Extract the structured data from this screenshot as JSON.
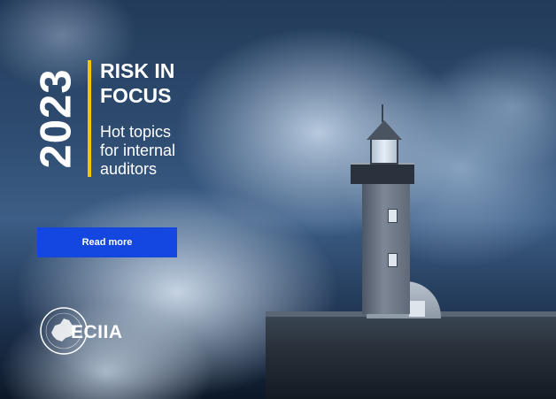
{
  "banner": {
    "year": "2023",
    "title_line_1": "RISK IN",
    "title_line_2": "FOCUS",
    "subtitle_line_1": "Hot topics",
    "subtitle_line_2": "for internal",
    "subtitle_line_3": "auditors",
    "cta_label": "Read more",
    "accent_color": "#f2c700",
    "button_color": "#1446e0"
  },
  "logo": {
    "name": "ECIIA",
    "seal_icon": "europe-map-seal-icon"
  },
  "background": {
    "scene": "lighthouse-in-storm-waves"
  }
}
